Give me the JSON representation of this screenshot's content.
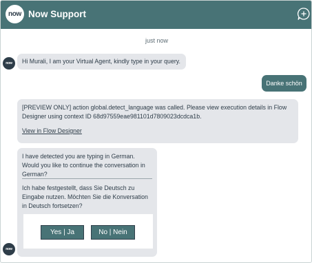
{
  "header": {
    "logo_text": "now",
    "title": "Now Support",
    "new_chat_icon": "chat-plus-icon"
  },
  "conversation": {
    "timestamp": "just now",
    "avatar_text": "now",
    "greeting": "Hi Murali, I am your Virtual Agent, kindly type in your query.",
    "user_message": "Danke schön",
    "preview_message": "[PREVIEW ONLY] action global.detect_language was called. Please view execution details in Flow Designer using context ID 68d97559eae981101d7809023dcdca1b.",
    "preview_link": "View in Flow Designer",
    "language_en": "I have detected you are typing in German. Would you like to continue the conversation in German?",
    "language_de": "Ich habe festgestellt, dass Sie Deutsch zu Eingabe nutzen. Möchten Sie die Konversation in Deutsch fortsetzen?",
    "yes_button": "Yes | Ja",
    "no_button": "No | Nein"
  },
  "colors": {
    "brand": "#487376",
    "bot_bubble": "#e4e6ea",
    "text": "#2e3d49"
  }
}
